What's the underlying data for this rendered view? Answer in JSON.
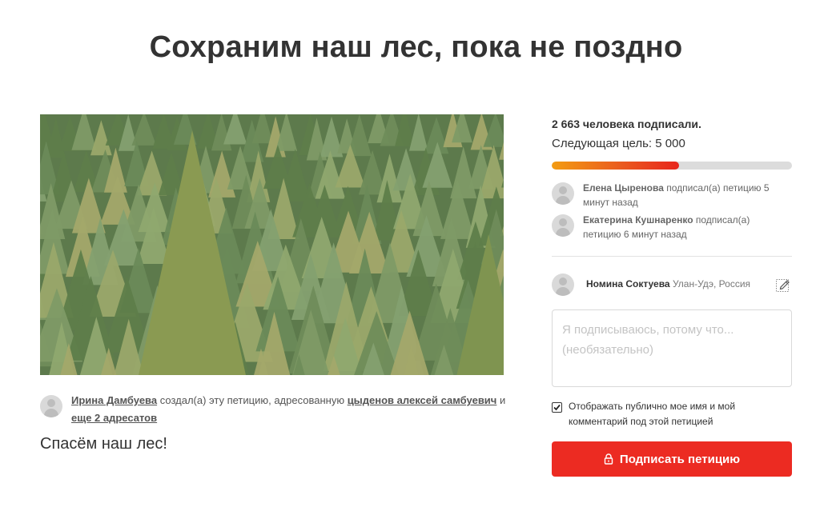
{
  "title": "Сохраним наш лес, пока не поздно",
  "hero": {
    "image_alt": "forest",
    "image_description": ""
  },
  "creator": {
    "name": "Ирина Дамбуева",
    "action": " создал(а) эту петицию, адресованную ",
    "recipient": "цыденов алексей самбуевич",
    "and": " и ",
    "more_recipients": "еще 2 адресатов"
  },
  "description": "Спасём наш лес!",
  "stats": {
    "signatures": "2 663 человека подписали.",
    "next_goal": "Следующая цель: 5 000",
    "progress_fraction": 0.53
  },
  "recent_signers": [
    {
      "name": "Елена Цыренова",
      "text": " подписал(а) петицию 5 минут назад"
    },
    {
      "name": "Екатерина Кушнаренко",
      "text": " подписал(а) петицию 6 минут назад"
    }
  ],
  "signer": {
    "name": "Номина Соктуева",
    "location": "Улан-Удэ, Россия"
  },
  "comment": {
    "placeholder": "Я подписываюсь, потому что... (необязательно)",
    "value": ""
  },
  "consent": {
    "label": "Отображать публично мое имя и мой комментарий под этой петицией",
    "checked": true
  },
  "sign_button": {
    "label": "Подписать петицию"
  },
  "colors": {
    "accent": "#ec2b22",
    "progress_start": "#f39c12",
    "progress_end": "#e8251c"
  },
  "icons": {
    "edit": "pencil-edit-icon",
    "lock": "lock-icon",
    "avatar": "avatar-placeholder-icon"
  }
}
